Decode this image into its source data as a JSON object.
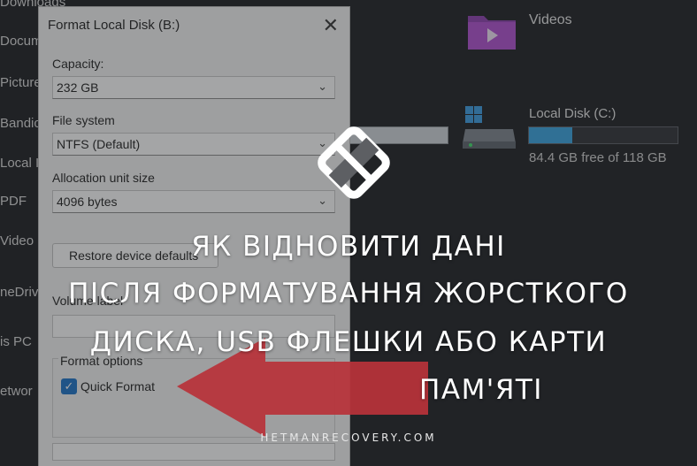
{
  "sidebar": {
    "items": [
      "Downloads",
      "Docum",
      "Picture",
      "Bandic",
      "Local I",
      "PDF",
      "Video",
      "neDriv",
      "is PC",
      "etwor"
    ]
  },
  "explorer": {
    "videos_label": "Videos",
    "drive_c": {
      "label": "Local Disk (C:)",
      "free_text": "84.4 GB free of 118 GB",
      "used_fraction": 0.29
    },
    "colors": {
      "drive_fill": "#36a3e0",
      "folder": "#b04fd1"
    }
  },
  "dialog": {
    "title": "Format Local Disk (B:)",
    "close_glyph": "✕",
    "capacity_label": "Capacity:",
    "capacity_value": "232 GB",
    "fs_label": "File system",
    "fs_value": "NTFS (Default)",
    "alloc_label": "Allocation unit size",
    "alloc_value": "4096 bytes",
    "restore_button": "Restore device defaults",
    "volume_label": "Volume label",
    "format_options": "Format options",
    "quick_format": "Quick Format",
    "quick_format_checked": true
  },
  "overlay": {
    "headline": [
      "ЯК ВІДНОВИТИ ДАНІ",
      "ПІСЛЯ ФОРМАТУВАННЯ ЖОРСТКОГО",
      "ДИСКА, USB ФЛЕШКИ АБО КАРТИ",
      "ПАМ'ЯТІ"
    ],
    "site": "HETMANRECOVERY.COM",
    "arrow_color": "#b8333a",
    "logo_icon": "hetman-logo-icon"
  }
}
